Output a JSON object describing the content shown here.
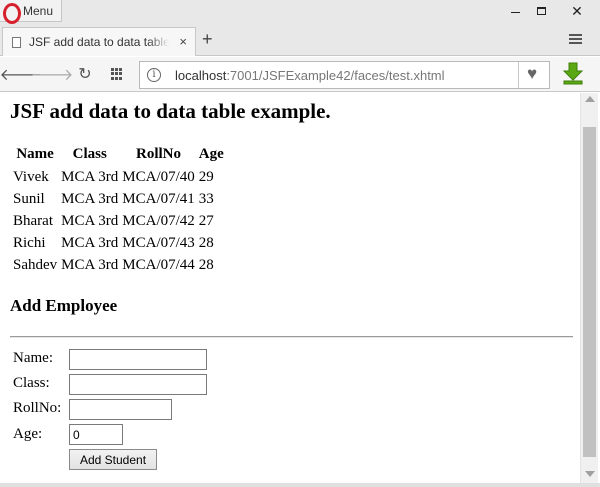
{
  "window": {
    "menu_label": "Menu",
    "minimize_glyph": "—",
    "close_glyph": "✕"
  },
  "tabs": [
    {
      "title": "JSF add data to data table example.",
      "close_glyph": "×"
    }
  ],
  "tabbar": {
    "new_tab_glyph": "+"
  },
  "navbar": {
    "back_glyph": "🡐",
    "forward_glyph": "🡒",
    "reload_glyph": "↻",
    "url_host": "localhost",
    "url_rest": ":7001/JSFExample42/faces/test.xhtml",
    "info_glyph": "i",
    "heart_glyph": "♥"
  },
  "page": {
    "title": "JSF add data to data table example.",
    "table": {
      "headers": [
        "Name",
        "Class",
        "RollNo",
        "Age"
      ],
      "rows": [
        [
          "Vivek",
          "MCA 3rd",
          "MCA/07/40",
          "29"
        ],
        [
          "Sunil",
          "MCA 3rd",
          "MCA/07/41",
          "33"
        ],
        [
          "Bharat",
          "MCA 3rd",
          "MCA/07/42",
          "27"
        ],
        [
          "Richi",
          "MCA 3rd",
          "MCA/07/43",
          "28"
        ],
        [
          "Sahdev",
          "MCA 3rd",
          "MCA/07/44",
          "28"
        ]
      ]
    },
    "add_heading": "Add Employee",
    "form": {
      "name_label": "Name:",
      "name_value": "",
      "class_label": "Class:",
      "class_value": "",
      "rollno_label": "RollNo:",
      "rollno_value": "",
      "age_label": "Age:",
      "age_value": "0",
      "submit_label": "Add Student"
    }
  },
  "colors": {
    "opera_red": "#d6202b",
    "download_green": "#5aa814"
  }
}
